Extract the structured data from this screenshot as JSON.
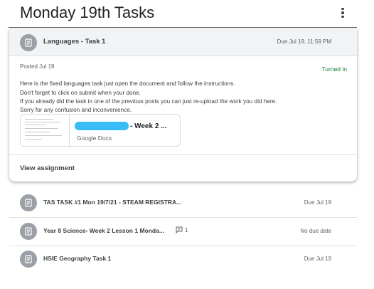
{
  "header": {
    "title": "Monday 19th Tasks",
    "menu_icon": "more-vert-icon"
  },
  "expanded_task": {
    "icon": "assignment-icon",
    "title": "Languages - Task 1",
    "due": "Due Jul 19, 11:59 PM",
    "posted": "Posted Jul 19",
    "status": "Turned in",
    "instructions": [
      "Here is the fixed languages task just open the document and follow the instructions.",
      "Don't forget to click on submit when your done.",
      "If you already did the task in one of the previous posts you can just re-upload the work you did here.",
      "Sorry for any confusion and inconvenience."
    ],
    "attachment": {
      "name": "- Week 2 ...",
      "type": "Google Docs"
    },
    "view_link": "View assignment"
  },
  "tasks": [
    {
      "title": "TAS TASK #1 Mon 19/7/21 - STEAM REGISTRA...",
      "meta": "Due Jul 19",
      "icon": "assignment-icon"
    },
    {
      "title": "Year 8 Science- Week 2 Lesson 1 Monda...",
      "meta": "No due date",
      "comment_count": "1",
      "icon": "assignment-icon"
    },
    {
      "title": "HSIE Geography Task 1",
      "meta": "Due Jul 19",
      "icon": "assignment-icon"
    }
  ],
  "colors": {
    "status_green": "#188038",
    "icon_grey": "#9aa0a6",
    "redaction": "#38bdf8"
  }
}
